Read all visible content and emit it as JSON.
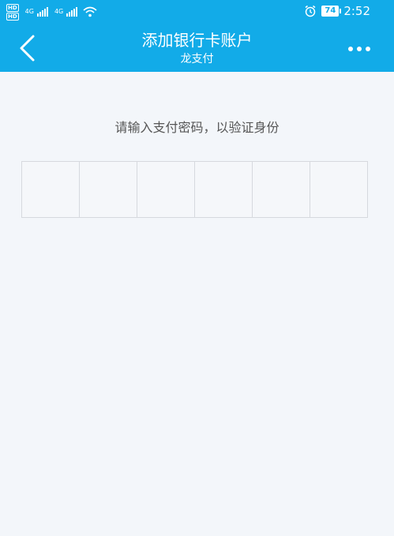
{
  "status_bar": {
    "hd_badge_top": "HD",
    "hd_badge_bottom": "HD",
    "network_1": "4G",
    "network_2": "4G",
    "battery": "74",
    "time": "2:52"
  },
  "header": {
    "title": "添加银行卡账户",
    "subtitle": "龙支付"
  },
  "main": {
    "prompt": "请输入支付密码，以验证身份",
    "pin_cells": 6
  },
  "colors": {
    "accent": "#12abe8",
    "background": "#f3f6fa"
  }
}
